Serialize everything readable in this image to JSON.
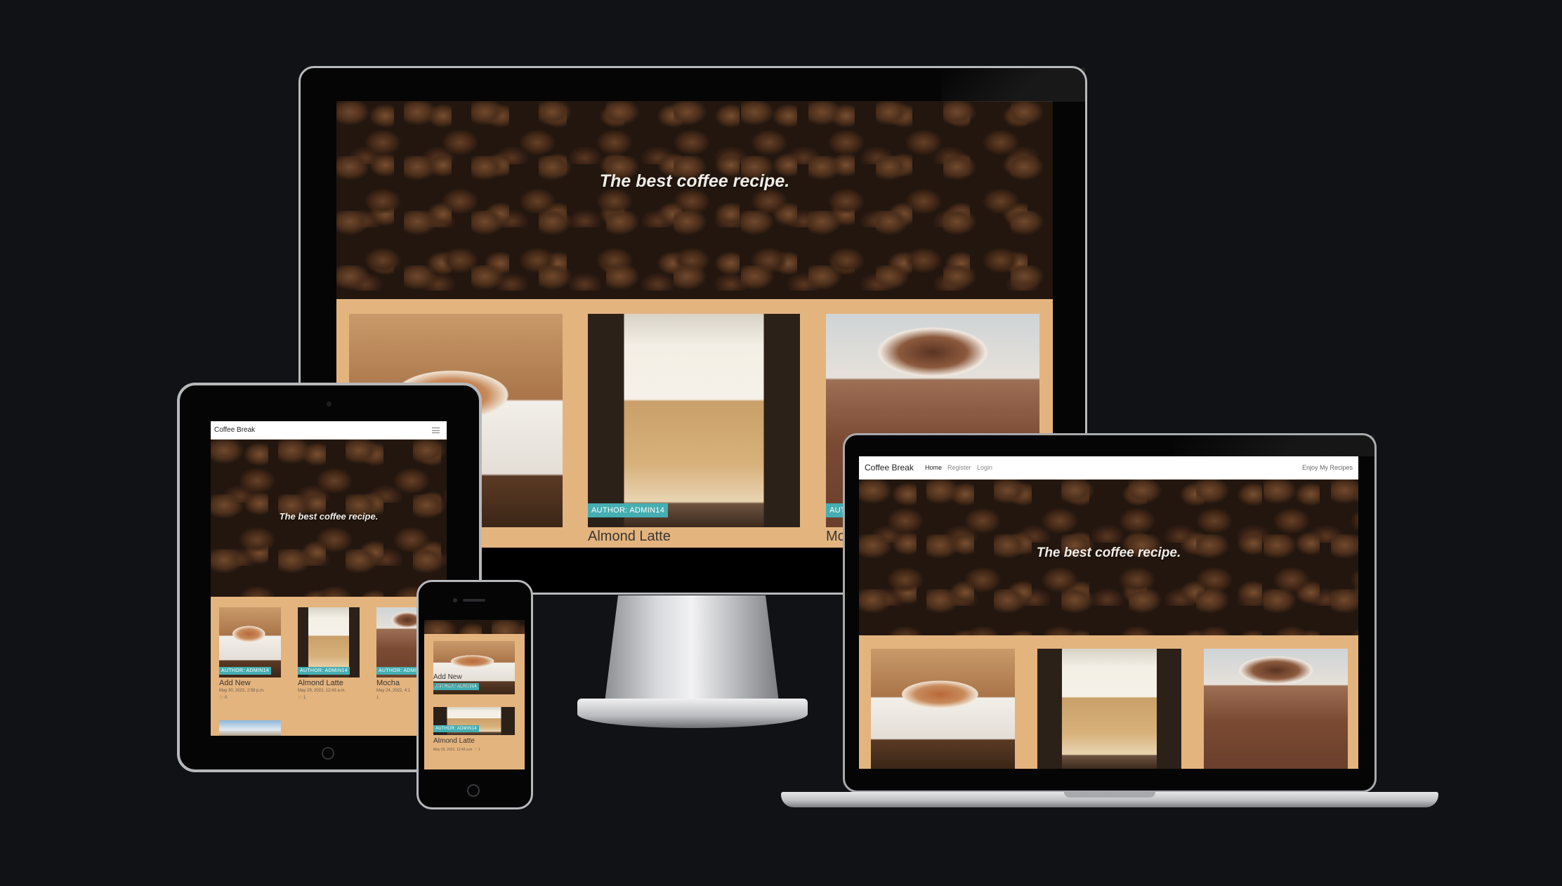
{
  "brand": "Coffee Break",
  "nav": {
    "home": "Home",
    "register": "Register",
    "login": "Login",
    "tagline": "Enjoy My Recipes"
  },
  "hero": {
    "heading": "The best coffee recipe."
  },
  "author_label": "AUTHOR: ADMIN14",
  "posts": [
    {
      "title": "Add New",
      "date": "May 30, 2022, 2:58 p.m.",
      "likes": "0",
      "image": "cappuccino"
    },
    {
      "title": "Almond Latte",
      "date": "May 29, 2022, 12:43 a.m.",
      "likes": "1",
      "image": "latte"
    },
    {
      "title": "Mocha",
      "date": "May 24, 2022, 4:1",
      "likes": "1",
      "image": "mocha"
    }
  ],
  "desktop_partial_title": "Mo",
  "desktop_partial_badge": "AUT",
  "mobile_meta_add_new": "May 30, 2022, 2:58 p.m. ♡ 0",
  "mobile_meta_latte": "May 29, 2022, 12:43 a.m. ♡ 1",
  "icons": {
    "menu": "hamburger-menu-icon",
    "heart": "heart-icon",
    "camera": "camera-icon",
    "home_button": "home-button-icon"
  },
  "colors": {
    "page_bg": "#111215",
    "content_bg": "#e4b47f",
    "badge": "#45aeb2",
    "navbar_bg": "#ffffff"
  }
}
